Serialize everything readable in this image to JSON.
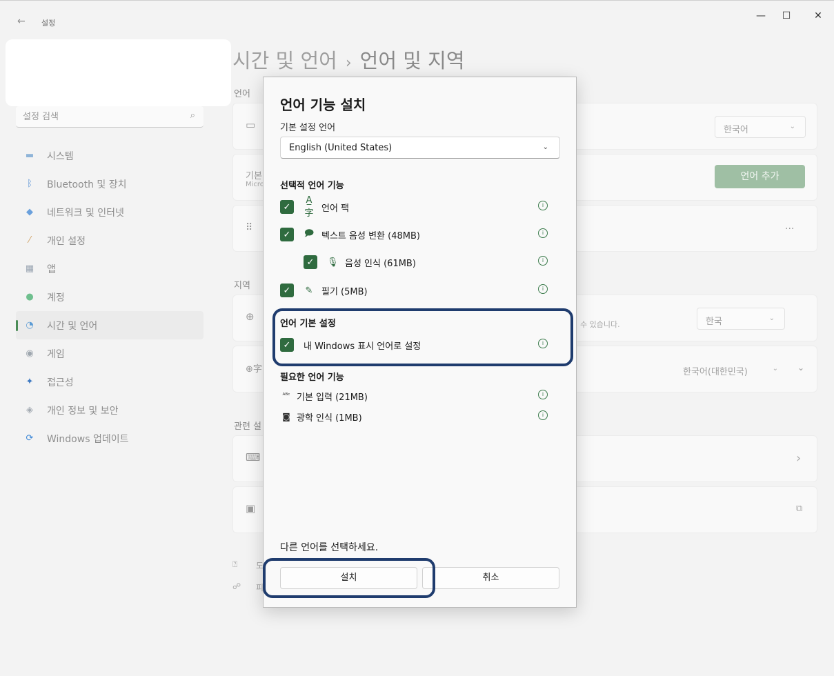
{
  "window": {
    "title": "설정",
    "back_glyph": "←",
    "minimize_glyph": "—",
    "maximize_glyph": "☐",
    "close_glyph": "✕"
  },
  "sidebar": {
    "search_placeholder": "설정 검색",
    "search_icon_glyph": "⌕",
    "items": [
      {
        "label": "시스템",
        "icon": "system-icon",
        "color": "#8fb4d8"
      },
      {
        "label": "Bluetooth 및 장치",
        "icon": "bluetooth-icon",
        "color": "#5b93d6"
      },
      {
        "label": "네트워크 및 인터넷",
        "icon": "wifi-icon",
        "color": "#6aa0dc"
      },
      {
        "label": "개인 설정",
        "icon": "brush-icon",
        "color": "#d2a46a"
      },
      {
        "label": "앱",
        "icon": "apps-icon",
        "color": "#9aa5b2"
      },
      {
        "label": "계정",
        "icon": "account-icon",
        "color": "#6fbf8e"
      },
      {
        "label": "시간 및 언어",
        "icon": "time-language-icon",
        "color": "#5a9bd5",
        "active": true
      },
      {
        "label": "게임",
        "icon": "gaming-icon",
        "color": "#9ea6ae"
      },
      {
        "label": "접근성",
        "icon": "accessibility-icon",
        "color": "#3d79c2"
      },
      {
        "label": "개인 정보 및 보안",
        "icon": "shield-icon",
        "color": "#a3aab2"
      },
      {
        "label": "Windows 업데이트",
        "icon": "update-icon",
        "color": "#3b86d6"
      }
    ]
  },
  "main": {
    "breadcrumb_parent": "시간 및 언어",
    "breadcrumb_sep": "›",
    "breadcrumb_current": "언어 및 지역",
    "section_language": "언어",
    "section_region": "지역",
    "section_related": "관련 설",
    "display_lang_value": "한국어",
    "preferred_prefix": "기본",
    "preferred_sub": "Micro",
    "add_language_label": "언어 추가",
    "more_glyph": "···",
    "region_hint": "수 있습니다.",
    "country_value": "한국",
    "format_value": "한국어(대한민국)",
    "chevron_right": "›",
    "external_glyph": "⧉",
    "help_prefix_1": "도",
    "help_prefix_2": "피"
  },
  "dialog": {
    "title": "언어 기능 설치",
    "preferred_label": "기본 설정 언어",
    "preferred_value": "English (United States)",
    "optional_heading": "선택적 언어 기능",
    "optional_features": [
      {
        "label": "언어 팩",
        "icon_glyph": "A̲字",
        "icon": "language-pack-icon"
      },
      {
        "label": "텍스트 음성 변환 (48MB)",
        "icon_glyph": "🗩",
        "icon": "text-to-speech-icon"
      },
      {
        "label": "음성 인식 (61MB)",
        "icon_glyph": "🎙",
        "icon": "microphone-icon"
      },
      {
        "label": "필기 (5MB)",
        "icon_glyph": "✎",
        "icon": "handwriting-icon"
      }
    ],
    "pref_heading": "언어 기본 설정",
    "display_lang_option": "내 Windows 표시 언어로 설정",
    "required_heading": "필요한 언어 기능",
    "required_features": [
      {
        "label": "기본 입력 (21MB)",
        "icon_glyph": "ᴬᴮᶜ",
        "icon": "spellcheck-icon"
      },
      {
        "label": "광학 인식 (1MB)",
        "icon_glyph": "◙",
        "icon": "ocr-icon"
      }
    ],
    "other_language_link": "다른 언어를 선택하세요.",
    "install_label": "설치",
    "cancel_label": "취소",
    "check_glyph": "✓",
    "info_glyph": "i"
  }
}
